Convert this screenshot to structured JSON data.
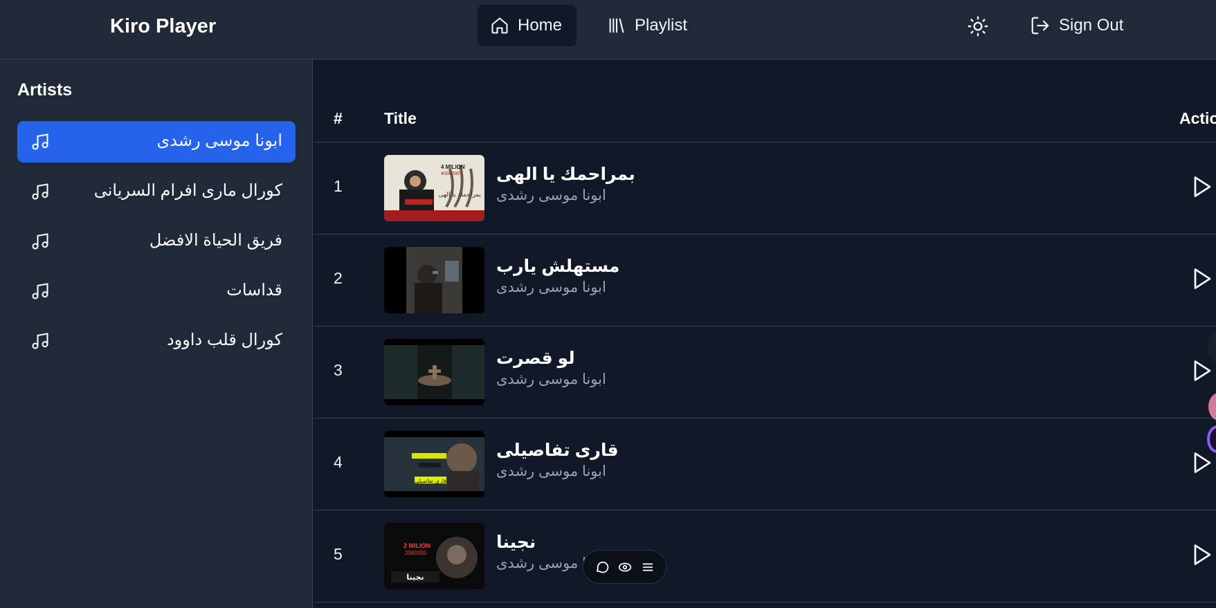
{
  "header": {
    "brand": "Kiro Player",
    "nav": {
      "home": "Home",
      "playlist": "Playlist"
    },
    "theme_icon": "sun-icon",
    "sign_out": "Sign Out"
  },
  "sidebar": {
    "title": "Artists",
    "items": [
      {
        "label": "ابونا موسى رشدى",
        "active": true
      },
      {
        "label": "كورال مارى افرام السريانى",
        "active": false
      },
      {
        "label": "فريق الحياة الافضل",
        "active": false
      },
      {
        "label": "قداسات",
        "active": false
      },
      {
        "label": "كورال قلب داوود",
        "active": false
      }
    ]
  },
  "table": {
    "headers": {
      "num": "#",
      "title": "Title",
      "actions": "Actio"
    },
    "rows": [
      {
        "num": "1",
        "title": "بمراحمك يا الهى",
        "artist": "ابونا موسى رشدى"
      },
      {
        "num": "2",
        "title": "مستهلش يارب",
        "artist": "ابونا موسى رشدى"
      },
      {
        "num": "3",
        "title": "لو قصرت",
        "artist": "ابونا موسى رشدى"
      },
      {
        "num": "4",
        "title": "قارى تفاصيلى",
        "artist": "ابونا موسى رشدى"
      },
      {
        "num": "5",
        "title": "نجينا",
        "artist": "ابونا موسى رشدى"
      }
    ],
    "thumbs": [
      {
        "badge": "4 MILION",
        "badge2": "4000000",
        "overlay": "بمراحمك يا الهى"
      },
      {
        "badge": "",
        "badge2": "",
        "overlay": ""
      },
      {
        "badge": "",
        "badge2": "",
        "overlay": ""
      },
      {
        "badge": "",
        "badge2": "",
        "overlay": "قارى تفاصيلى"
      },
      {
        "badge": "2 MILION",
        "badge2": "2000000",
        "overlay": "نجينا"
      }
    ]
  },
  "colors": {
    "accent": "#2563eb",
    "background": "#111827",
    "panel": "#1f2937",
    "divider": "#374151",
    "muted_text": "#9ca3af"
  }
}
